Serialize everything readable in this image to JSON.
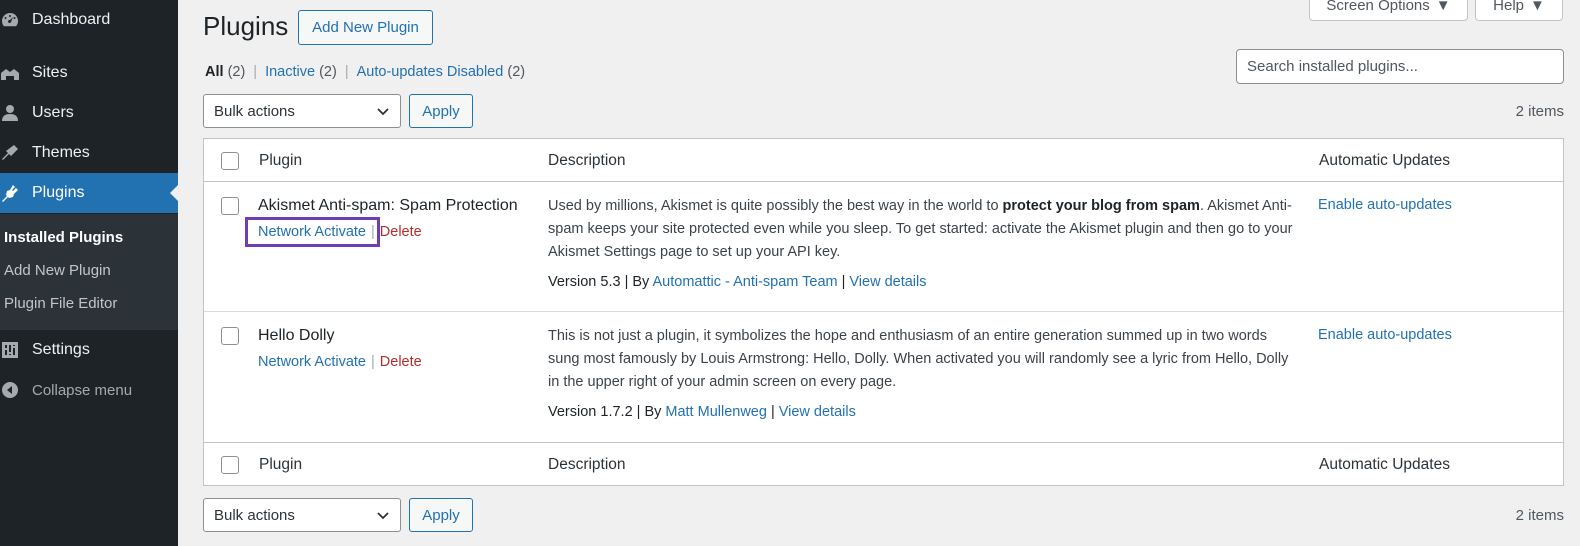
{
  "sidebar": {
    "items": [
      {
        "label": "Dashboard",
        "icon": "dashboard-icon"
      },
      {
        "label": "Sites",
        "icon": "sites-icon"
      },
      {
        "label": "Users",
        "icon": "users-icon"
      },
      {
        "label": "Themes",
        "icon": "themes-icon"
      },
      {
        "label": "Plugins",
        "icon": "plugins-icon",
        "current": true
      },
      {
        "label": "Settings",
        "icon": "settings-icon"
      },
      {
        "label": "Collapse menu",
        "icon": "collapse-icon"
      }
    ],
    "submenu": [
      {
        "label": "Installed Plugins",
        "current": true
      },
      {
        "label": "Add New Plugin"
      },
      {
        "label": "Plugin File Editor"
      }
    ]
  },
  "header": {
    "title": "Plugins",
    "add_new_label": "Add New Plugin",
    "screen_options_label": "Screen Options",
    "help_label": "Help"
  },
  "filters": {
    "all_label": "All",
    "all_count": "(2)",
    "inactive_label": "Inactive",
    "inactive_count": "(2)",
    "autoupdates_label": "Auto-updates Disabled",
    "autoupdates_count": "(2)"
  },
  "search": {
    "placeholder": "Search installed plugins..."
  },
  "bulk": {
    "select_label": "Bulk actions",
    "apply_label": "Apply",
    "items_count": "2 items"
  },
  "table": {
    "columns": {
      "plugin": "Plugin",
      "description": "Description",
      "auto_updates": "Automatic Updates"
    },
    "rows": [
      {
        "name": "Akismet Anti-spam: Spam Protection",
        "activate_label": "Network Activate",
        "delete_label": "Delete",
        "desc_part1": "Used by millions, Akismet is quite possibly the best way in the world to ",
        "desc_bold": "protect your blog from spam",
        "desc_part2": ". Akismet Anti-spam keeps your site protected even while you sleep. To get started: activate the Akismet plugin and then go to your Akismet Settings page to set up your API key.",
        "version": "Version 5.3",
        "by_label": "By",
        "author": "Automattic - Anti-spam Team",
        "view_details": "View details",
        "auto_update_label": "Enable auto-updates"
      },
      {
        "name": "Hello Dolly",
        "activate_label": "Network Activate",
        "delete_label": "Delete",
        "desc_part1": "This is not just a plugin, it symbolizes the hope and enthusiasm of an entire generation summed up in two words sung most famously by Louis Armstrong: Hello, Dolly. When activated you will randomly see a lyric from Hello, Dolly in the upper right of your admin screen on every page.",
        "version": "Version 1.7.2",
        "by_label": "By",
        "author": "Matt Mullenweg",
        "view_details": "View details",
        "auto_update_label": "Enable auto-updates"
      }
    ]
  },
  "colors": {
    "accent": "#2271b1",
    "sidebar": "#1d2327",
    "delete": "#b32d2e",
    "highlight": "#6c3fb5"
  }
}
